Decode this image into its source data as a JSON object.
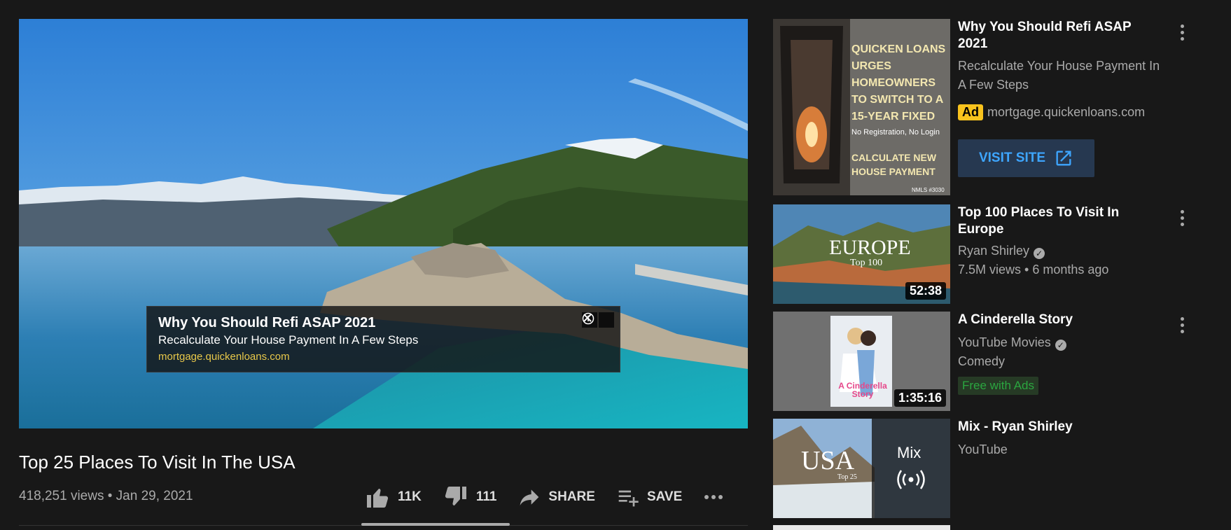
{
  "player": {
    "ad": {
      "title": "Why You Should Refi ASAP 2021",
      "description": "Recalculate Your House Payment In A Few Steps",
      "url": "mortgage.quickenloans.com"
    }
  },
  "video": {
    "title": "Top 25 Places To Visit In The USA",
    "meta": "418,251 views • Jan 29, 2021",
    "actions": {
      "like": "11K",
      "dislike": "111",
      "share": "SHARE",
      "save": "SAVE"
    }
  },
  "sidebar": {
    "ad": {
      "title": "Why You Should Refi ASAP 2021",
      "description": "Recalculate Your House Payment In A Few Steps",
      "badge": "Ad",
      "domain": "mortgage.quickenloans.com",
      "button": "VISIT SITE",
      "thumb_text": "QUICKEN LOANS URGES HOMEOWNERS TO SWITCH TO A 15-YEAR FIXED",
      "thumb_sub": "No Registration, No Login",
      "thumb_cta": "CALCULATE NEW HOUSE PAYMENT",
      "thumb_nmls": "NMLS #3030"
    },
    "items": [
      {
        "title": "Top 100 Places To Visit In Europe",
        "channel": "Ryan Shirley",
        "stats": "7.5M views • 6 months ago",
        "duration": "52:38",
        "thumb_text": "EUROPE",
        "thumb_sub": "Top 100"
      },
      {
        "title": "A Cinderella Story",
        "channel": "YouTube Movies",
        "genre": "Comedy",
        "badge": "Free with Ads",
        "duration": "1:35:16",
        "thumb_text": "A Cinderella Story"
      },
      {
        "title": "Mix - Ryan Shirley",
        "channel": "YouTube",
        "thumb_text": "USA",
        "thumb_sub": "Top 25",
        "mix_label": "Mix"
      }
    ]
  }
}
